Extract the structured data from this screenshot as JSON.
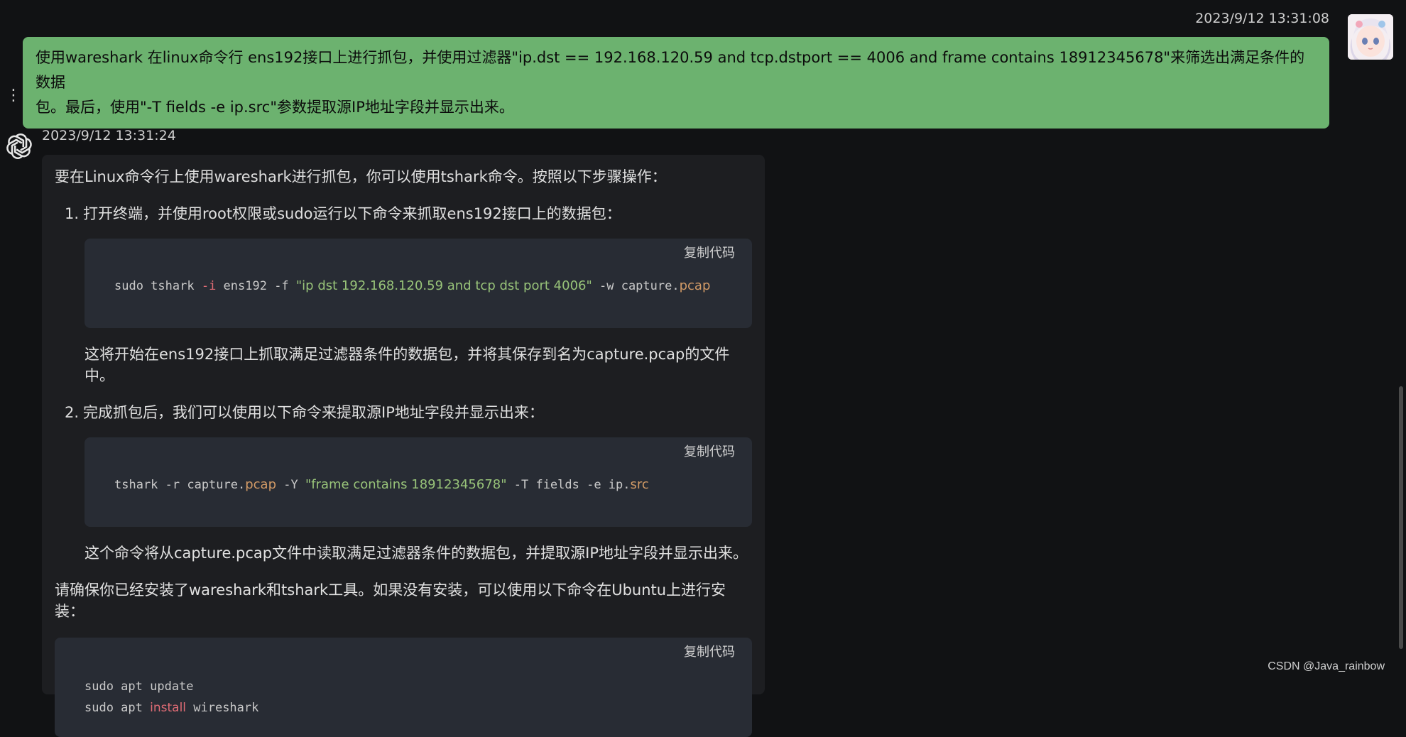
{
  "user_message": {
    "time": "2023/9/12 13:31:08",
    "line1": "使用wareshark 在linux命令行 ens192接口上进行抓包，并使用过滤器\"ip.dst == 192.168.120.59 and tcp.dstport == 4006 and frame contains 18912345678\"来筛选出满足条件的数据",
    "line2": "包。最后，使用\"-T fields -e ip.src\"参数提取源IP地址字段并显示出来。"
  },
  "bot_message": {
    "time": "2023/9/12 13:31:24",
    "intro": "要在Linux命令行上使用wareshark进行抓包，你可以使用tshark命令。按照以下步骤操作：",
    "step1_num": "1.",
    "step1": "打开终端，并使用root权限或sudo运行以下命令来抓取ens192接口上的数据包：",
    "code1": {
      "copy": "复制代码",
      "t1": "sudo tshark ",
      "t2": "-i",
      "t3": " ens192 -f ",
      "t4": "\"ip dst 192.168.120.59 and tcp dst port 4006\"",
      "t5": " -w capture.",
      "t6": "pcap"
    },
    "step1_note": "这将开始在ens192接口上抓取满足过滤器条件的数据包，并将其保存到名为capture.pcap的文件中。",
    "step2_num": "2.",
    "step2": "完成抓包后，我们可以使用以下命令来提取源IP地址字段并显示出来：",
    "code2": {
      "copy": "复制代码",
      "t1": "tshark -r capture.",
      "t2": "pcap",
      "t3": " -Y ",
      "t4": "\"frame contains 18912345678\"",
      "t5": " -T fields -e ip.",
      "t6": "src"
    },
    "step2_note": "这个命令将从capture.pcap文件中读取满足过滤器条件的数据包，并提取源IP地址字段并显示出来。",
    "install_note": "请确保你已经安装了wareshark和tshark工具。如果没有安装，可以使用以下命令在Ubuntu上进行安装：",
    "code3": {
      "copy": "复制代码",
      "line1": "sudo apt update",
      "l2a": "sudo apt ",
      "l2b": "install",
      "l2c": " wireshark"
    }
  },
  "watermark": "CSDN @Java_rainbow"
}
